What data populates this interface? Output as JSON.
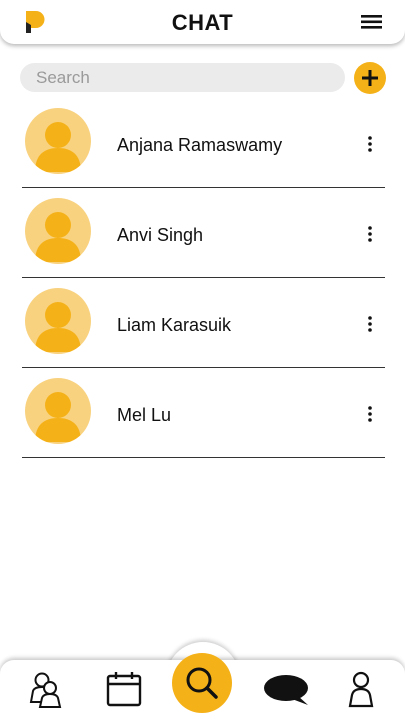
{
  "app": {
    "title": "CHAT"
  },
  "colors": {
    "accent": "#f5b118",
    "avatar_bg": "#f9d27f",
    "avatar_figure": "#f5b118"
  },
  "header": {
    "logo_icon": "app-logo-icon",
    "menu_icon": "hamburger-menu-icon"
  },
  "search": {
    "placeholder": "Search",
    "value": "",
    "add_icon": "plus-icon"
  },
  "contacts": [
    {
      "name": "Anjana Ramaswamy",
      "avatar_icon": "user-avatar-icon",
      "more_icon": "more-vertical-icon"
    },
    {
      "name": "Anvi Singh",
      "avatar_icon": "user-avatar-icon",
      "more_icon": "more-vertical-icon"
    },
    {
      "name": "Liam Karasuik",
      "avatar_icon": "user-avatar-icon",
      "more_icon": "more-vertical-icon"
    },
    {
      "name": "Mel Lu",
      "avatar_icon": "user-avatar-icon",
      "more_icon": "more-vertical-icon"
    }
  ],
  "bottom_nav": {
    "items": [
      {
        "id": "friends",
        "icon": "users-icon"
      },
      {
        "id": "calendar",
        "icon": "calendar-icon"
      },
      {
        "id": "search",
        "icon": "search-icon",
        "active": true
      },
      {
        "id": "chat",
        "icon": "chat-bubble-icon"
      },
      {
        "id": "profile",
        "icon": "person-icon"
      }
    ]
  }
}
